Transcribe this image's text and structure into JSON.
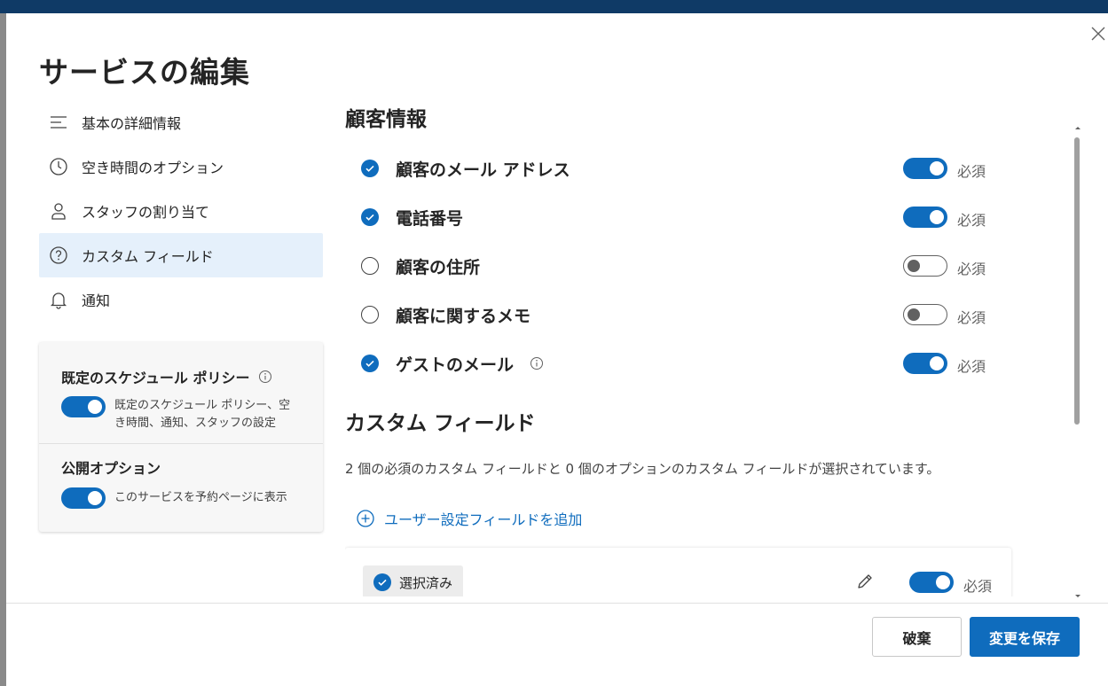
{
  "dialog": {
    "title": "サービスの編集"
  },
  "nav": {
    "items": [
      {
        "label": "基本の詳細情報",
        "icon": "list-icon"
      },
      {
        "label": "空き時間のオプション",
        "icon": "clock-icon"
      },
      {
        "label": "スタッフの割り当て",
        "icon": "person-icon"
      },
      {
        "label": "カスタム フィールド",
        "icon": "question-icon",
        "active": true
      },
      {
        "label": "通知",
        "icon": "bell-icon"
      }
    ]
  },
  "policy_card": {
    "default_policy_title": "既定のスケジュール ポリシー",
    "default_policy_desc": "既定のスケジュール ポリシー、空き時間、通知、スタッフの設定",
    "default_policy_on": true,
    "publish_title": "公開オプション",
    "publish_desc": "このサービスを予約ページに表示",
    "publish_on": true
  },
  "customer_info": {
    "title": "顧客情報",
    "required_label": "必須",
    "fields": [
      {
        "label": "顧客のメール アドレス",
        "checked": true,
        "required": true
      },
      {
        "label": "電話番号",
        "checked": true,
        "required": true
      },
      {
        "label": "顧客の住所",
        "checked": false,
        "required": false
      },
      {
        "label": "顧客に関するメモ",
        "checked": false,
        "required": false
      },
      {
        "label": "ゲストのメール",
        "checked": true,
        "required": true,
        "info": true
      }
    ]
  },
  "custom_fields": {
    "title": "カスタム フィールド",
    "description": "2 個の必須のカスタム フィールドと 0 個のオプションのカスタム フィールドが選択されています。",
    "add_link": "ユーザー設定フィールドを追加",
    "card": {
      "selected_label": "選択済み",
      "required_label": "必須",
      "required_on": true
    }
  },
  "footer": {
    "discard_label": "破棄",
    "save_label": "変更を保存"
  },
  "colors": {
    "accent": "#0f6cbd",
    "nav_active_bg": "#e5f0fb",
    "topbar": "#0f3a66"
  }
}
